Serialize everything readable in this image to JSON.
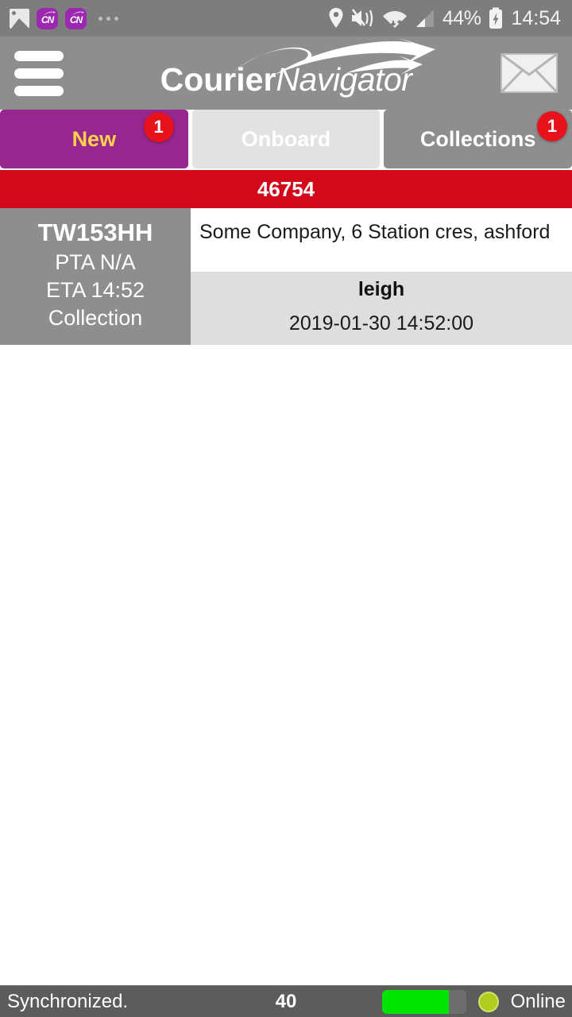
{
  "status_bar": {
    "notification_icons": [
      "gallery-icon",
      "courier-navigator-app-icon",
      "courier-navigator-app-icon",
      "more-notifications-icon"
    ],
    "system_icons": [
      "location-icon",
      "sound-mute-vibrate-icon",
      "wifi-icon",
      "cellular-signal-icon",
      "battery-charging-icon"
    ],
    "battery_percent": "44%",
    "clock": "14:54"
  },
  "app_bar": {
    "menu_icon": "hamburger-menu-icon",
    "logo_primary": "Courier",
    "logo_secondary": "Navigator",
    "messages_icon": "envelope-icon"
  },
  "tabs": [
    {
      "label": "New",
      "badge": "1",
      "active": true
    },
    {
      "label": "Onboard",
      "badge": "",
      "active": false
    },
    {
      "label": "Collections",
      "badge": "1",
      "active": false
    }
  ],
  "jobs": [
    {
      "reference": "46754",
      "registration": "TW153HH",
      "pta": "PTA N/A",
      "eta": "ETA 14:52",
      "type": "Collection",
      "address": "Some Company,  6 Station cres, ashford",
      "contact": "leigh",
      "timestamp": "2019-01-30 14:52:00"
    }
  ],
  "bottom_bar": {
    "sync_status": "Synchronized.",
    "count": "40",
    "progress_percent": 80,
    "connection_label": "Online",
    "connection_icon": "status-dot-icon"
  },
  "colors": {
    "accent_purple": "#97278f",
    "accent_yellow": "#ffd24d",
    "badge_red": "#e8121c",
    "banner_red": "#d2091b",
    "chrome_gray": "#8e8e8e",
    "status_gray": "#7d7d7d",
    "bottom_gray": "#5c5c5c",
    "progress_green": "#00e500",
    "online_green": "#b0cc1f"
  }
}
